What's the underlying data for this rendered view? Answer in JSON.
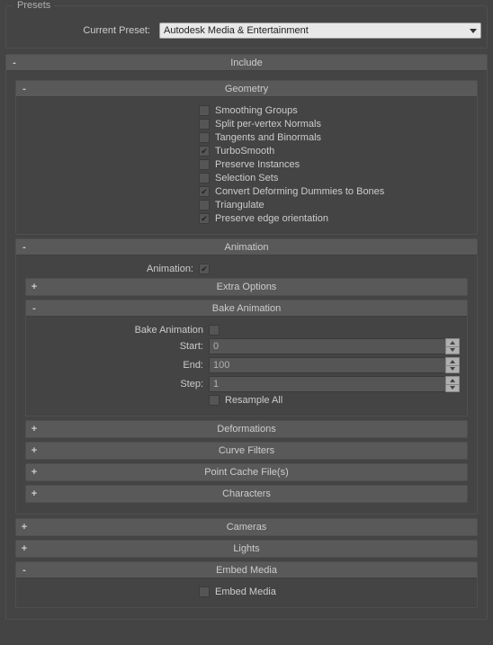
{
  "presets": {
    "legend": "Presets",
    "current_preset_label": "Current Preset:",
    "current_preset_value": "Autodesk Media & Entertainment"
  },
  "include": {
    "title": "Include",
    "toggle": "-"
  },
  "geometry": {
    "title": "Geometry",
    "toggle": "-",
    "options": {
      "smoothing_groups": {
        "label": "Smoothing Groups",
        "checked": false
      },
      "split_normals": {
        "label": "Split per-vertex Normals",
        "checked": false
      },
      "tangents": {
        "label": "Tangents and Binormals",
        "checked": false
      },
      "turbosmooth": {
        "label": "TurboSmooth",
        "checked": true
      },
      "preserve_instances": {
        "label": "Preserve Instances",
        "checked": false
      },
      "selection_sets": {
        "label": "Selection Sets",
        "checked": false
      },
      "convert_dummies": {
        "label": "Convert Deforming Dummies to Bones",
        "checked": true
      },
      "triangulate": {
        "label": "Triangulate",
        "checked": false
      },
      "preserve_edge": {
        "label": "Preserve edge orientation",
        "checked": true
      }
    }
  },
  "animation": {
    "title": "Animation",
    "toggle": "-",
    "enable_label": "Animation:",
    "enable_checked": true,
    "extra_options": {
      "title": "Extra Options",
      "toggle": "+"
    },
    "bake": {
      "title": "Bake Animation",
      "toggle": "-",
      "enable_label": "Bake Animation",
      "enable_checked": false,
      "start_label": "Start:",
      "start_value": "0",
      "end_label": "End:",
      "end_value": "100",
      "step_label": "Step:",
      "step_value": "1",
      "resample_all": {
        "label": "Resample All",
        "checked": false
      }
    },
    "deformations": {
      "title": "Deformations",
      "toggle": "+"
    },
    "curve_filters": {
      "title": "Curve Filters",
      "toggle": "+"
    },
    "point_cache": {
      "title": "Point Cache File(s)",
      "toggle": "+"
    },
    "characters": {
      "title": "Characters",
      "toggle": "+"
    }
  },
  "cameras": {
    "title": "Cameras",
    "toggle": "+"
  },
  "lights": {
    "title": "Lights",
    "toggle": "+"
  },
  "embed_media": {
    "title": "Embed Media",
    "toggle": "-",
    "option": {
      "label": "Embed Media",
      "checked": false
    }
  }
}
